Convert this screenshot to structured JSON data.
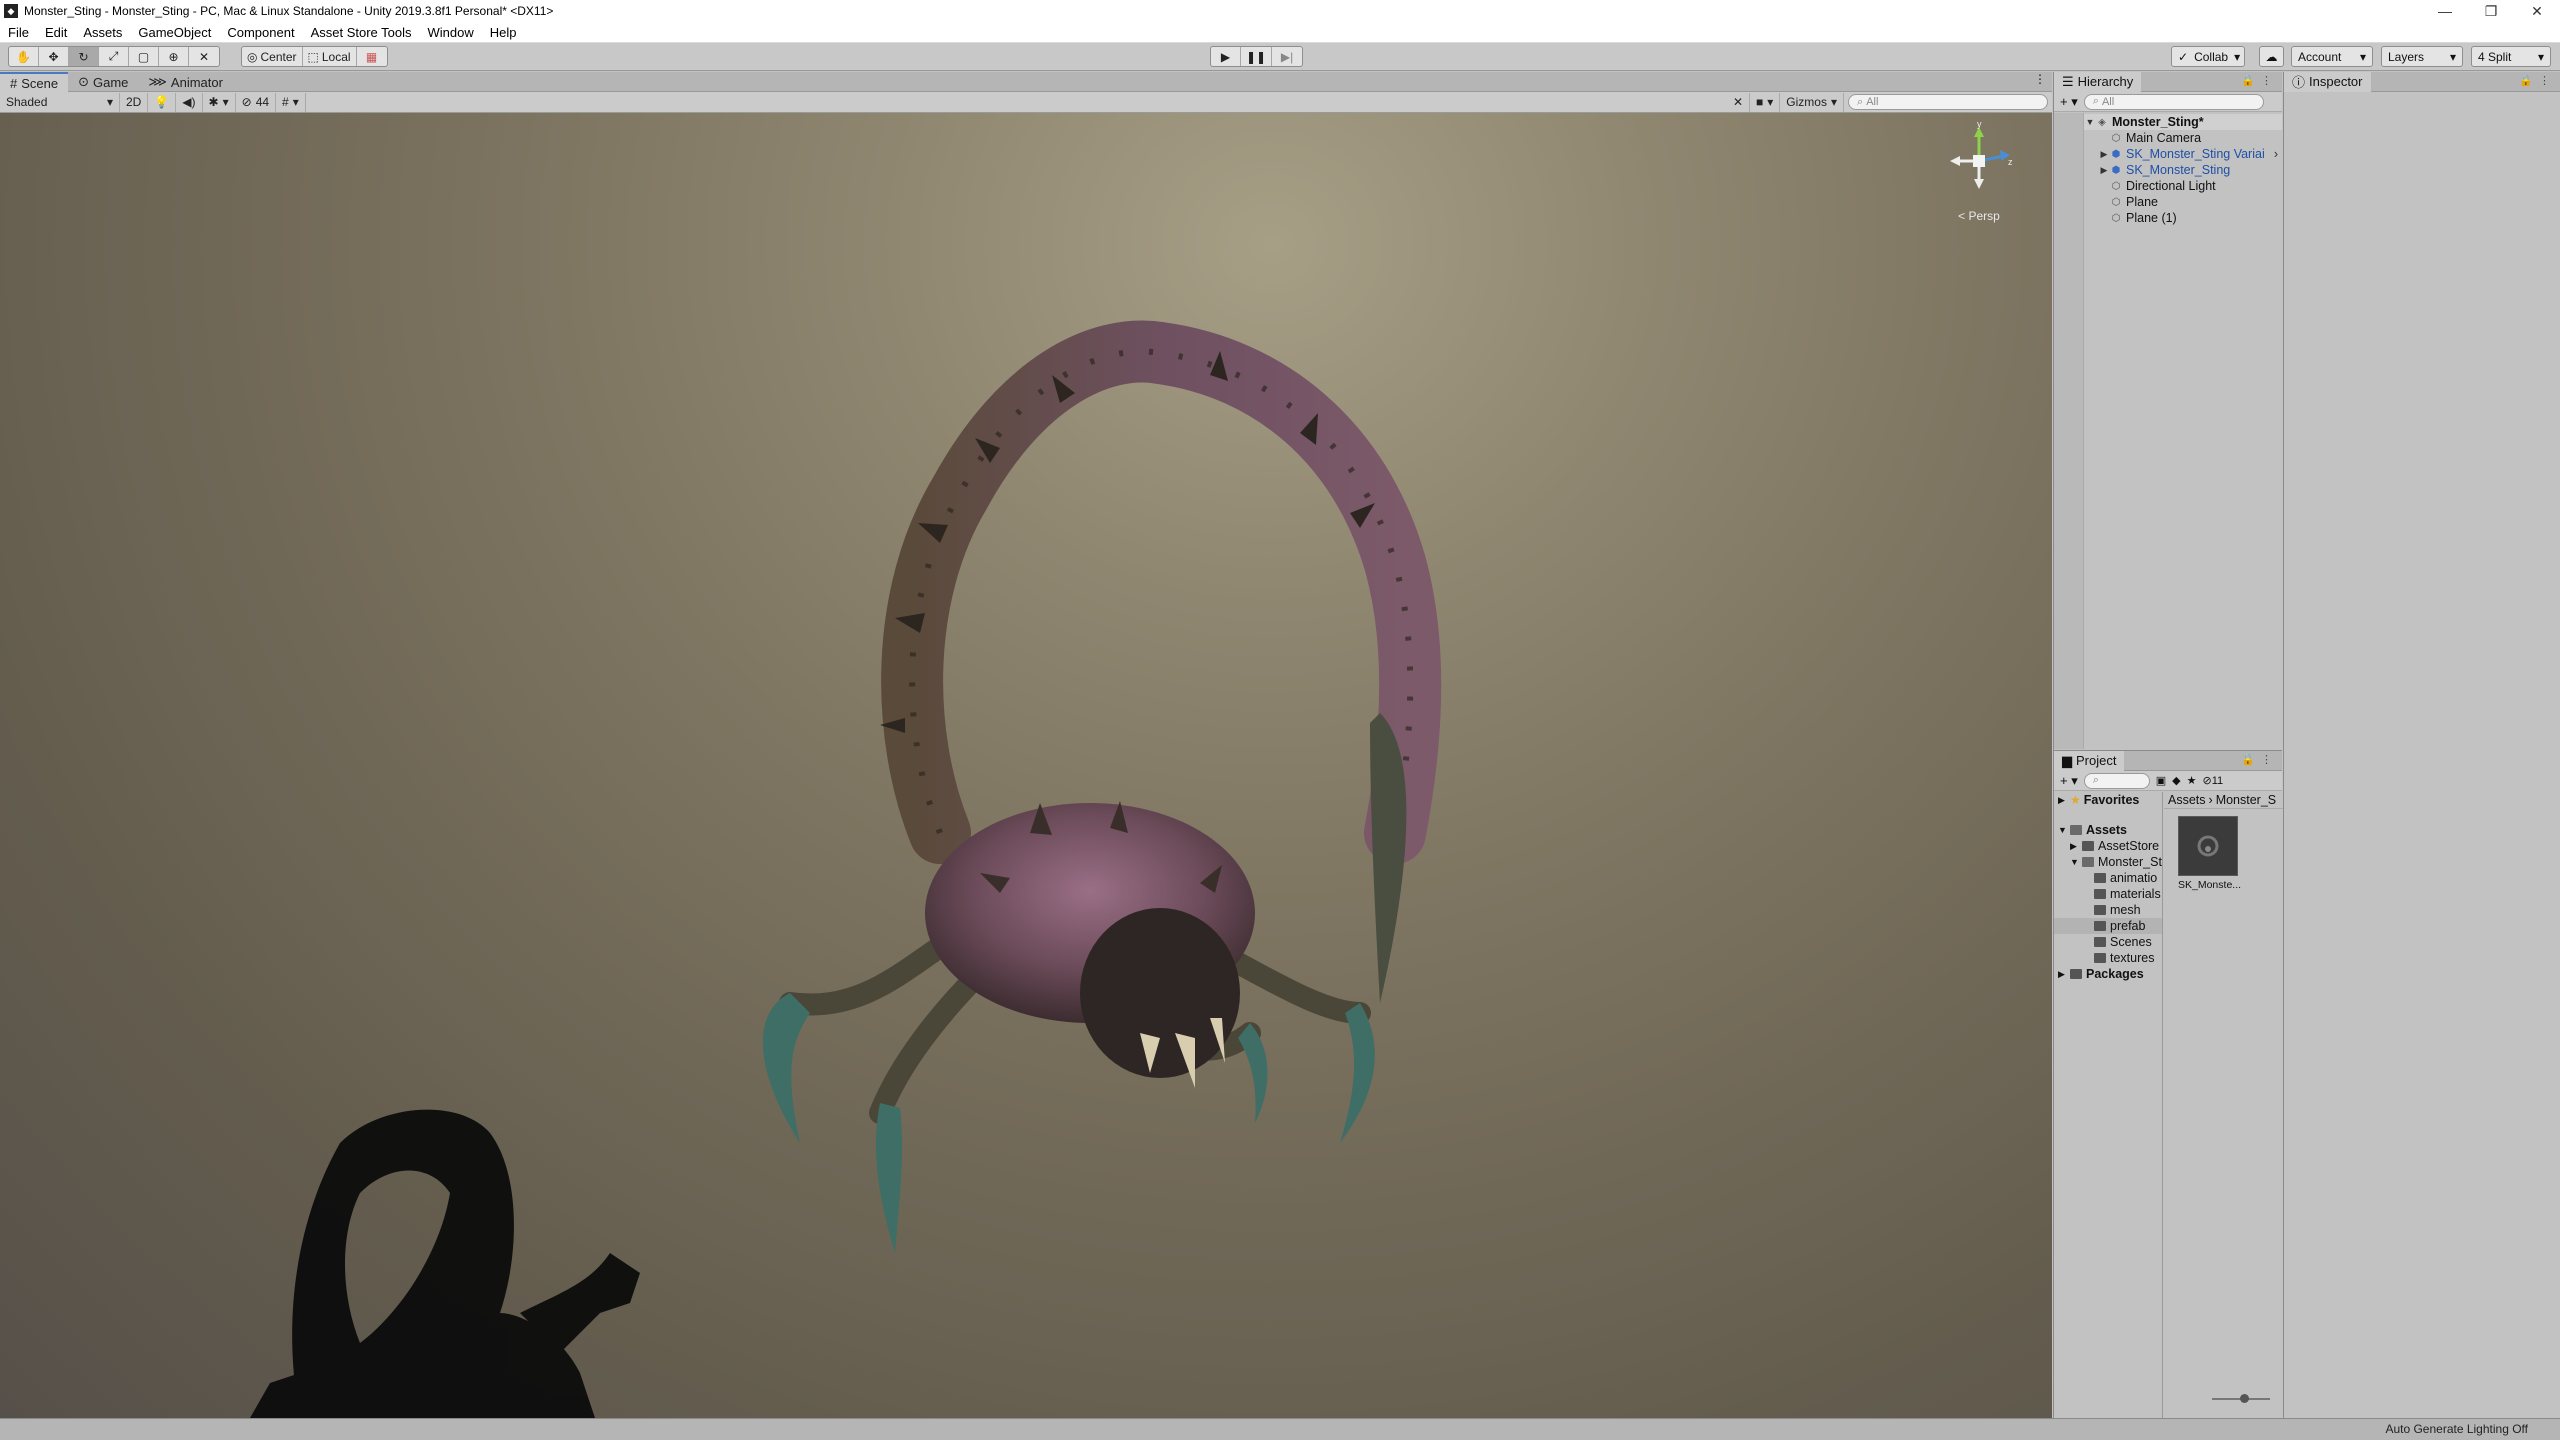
{
  "window": {
    "title": "Monster_Sting - Monster_Sting - PC, Mac & Linux Standalone - Unity 2019.3.8f1 Personal* <DX11>",
    "controls": [
      "—",
      "❐",
      "✕"
    ]
  },
  "menu": [
    "File",
    "Edit",
    "Assets",
    "GameObject",
    "Component",
    "Asset Store Tools",
    "Window",
    "Help"
  ],
  "toolbar": {
    "pivot_center": "Center",
    "pivot_local": "Local",
    "collab": "Collab",
    "account": "Account",
    "layers": "Layers",
    "layout": "4 Split"
  },
  "scene": {
    "tabs": [
      "Scene",
      "Game",
      "Animator"
    ],
    "draw_mode": "Shaded",
    "mode_2d": "2D",
    "hidden_count": "44",
    "gizmos": "Gizmos",
    "search_placeholder": "All",
    "persp_label": "< Persp",
    "gizmo_axes": {
      "y": "y",
      "z": "z"
    }
  },
  "hierarchy": {
    "tab": "Hierarchy",
    "search_placeholder": "All",
    "root": "Monster_Sting*",
    "items": [
      {
        "label": "Main Camera",
        "prefab": false,
        "expandable": false
      },
      {
        "label": "SK_Monster_Sting Variai",
        "prefab": true,
        "expandable": true
      },
      {
        "label": "SK_Monster_Sting",
        "prefab": true,
        "expandable": true
      },
      {
        "label": "Directional Light",
        "prefab": false,
        "expandable": false
      },
      {
        "label": "Plane",
        "prefab": false,
        "expandable": false
      },
      {
        "label": "Plane (1)",
        "prefab": false,
        "expandable": false
      }
    ]
  },
  "inspector": {
    "tab": "Inspector"
  },
  "project": {
    "tab": "Project",
    "hidden_count": "11",
    "favorites": "Favorites",
    "assets_root": "Assets",
    "tree": [
      "AssetStore",
      "Monster_St",
      "animatio",
      "materials",
      "mesh",
      "prefab",
      "Scenes",
      "textures"
    ],
    "packages": "Packages",
    "breadcrumb": [
      "Assets",
      "Monster_S"
    ],
    "asset_label": "SK_Monste..."
  },
  "status": {
    "text": "Auto Generate Lighting Off"
  }
}
